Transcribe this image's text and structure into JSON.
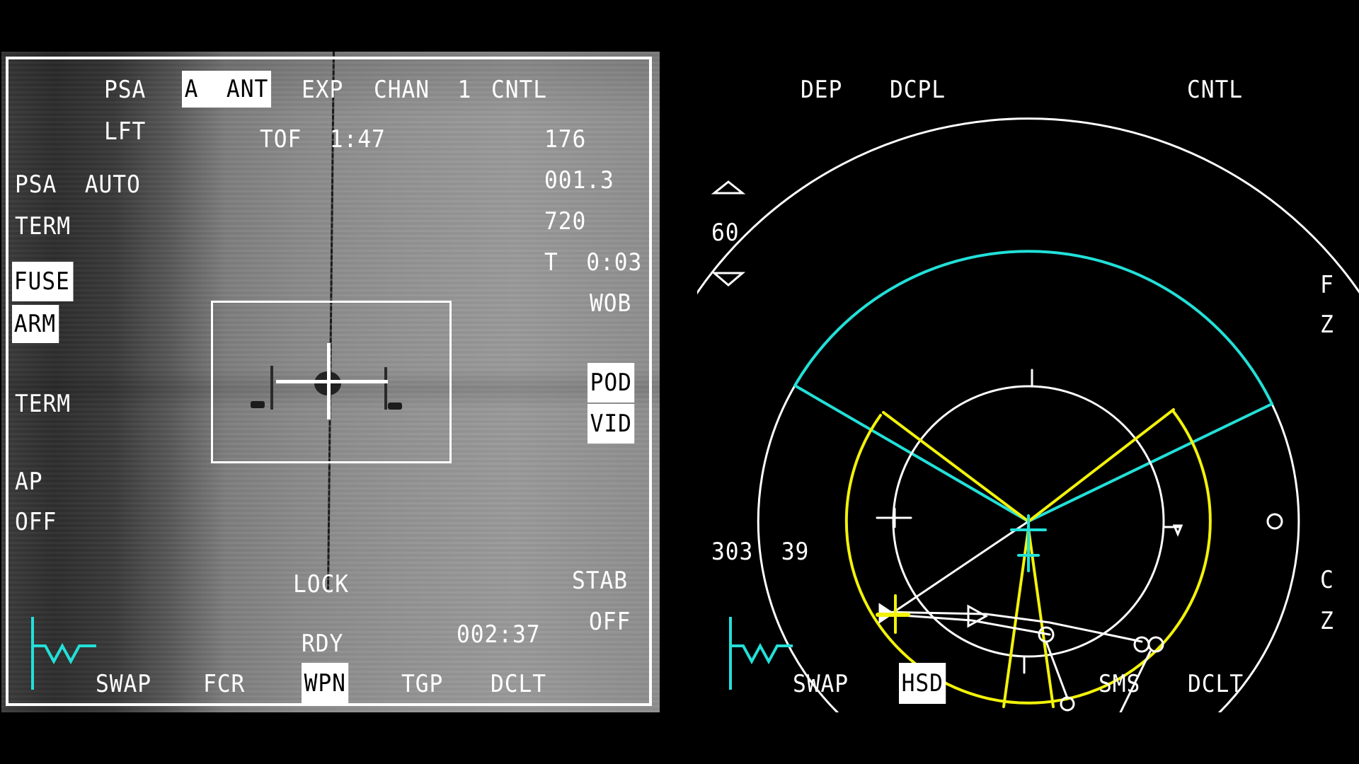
{
  "left_mfd": {
    "page": "TGP",
    "top_row": {
      "psa": "PSA",
      "mode_boxed": "A  ANT",
      "exp": "EXP",
      "chan": "CHAN  1",
      "cntl": "CNTL"
    },
    "lft": "LFT",
    "tof": "TOF  1:47",
    "right_readouts": [
      "176",
      "001.3",
      "720",
      "T  0:03",
      "WOB"
    ],
    "left_column": {
      "psa_auto": "PSA  AUTO",
      "term_1": "TERM",
      "fuse": "FUSE",
      "arm": "ARM",
      "term_2": "TERM",
      "ap": "AP",
      "ap_state": "OFF"
    },
    "pod": "POD",
    "vid": "VID",
    "lock": "LOCK",
    "stab": "STAB",
    "stab_state": "OFF",
    "rdy": "RDY",
    "timer": "002:37",
    "bottom_tabs": [
      "SWAP",
      "FCR",
      "WPN",
      "TGP",
      "DCLT"
    ],
    "selected_tab": "WPN",
    "icons": {
      "crosshair": "target-crosshair-icon",
      "emitter": "datalink-symbol-icon"
    }
  },
  "right_mfd": {
    "page": "HSD",
    "top_row": {
      "dep": "DEP",
      "dcpl": "DCPL",
      "cntl": "CNTL"
    },
    "range": "60",
    "range_up": "range-increase-icon",
    "range_down": "range-decrease-icon",
    "side_labels": {
      "fz_f": "F",
      "fz_z": "Z",
      "cz_c": "C",
      "cz_z": "Z"
    },
    "bullseye": "303  39",
    "bottom_tabs": [
      "SWAP",
      "HSD",
      "SMS",
      "DCLT"
    ],
    "selected_tab": "HSD",
    "colors": {
      "white": "#ffffff",
      "cyan": "#22e0d8",
      "yellow": "#f2f20a"
    }
  }
}
